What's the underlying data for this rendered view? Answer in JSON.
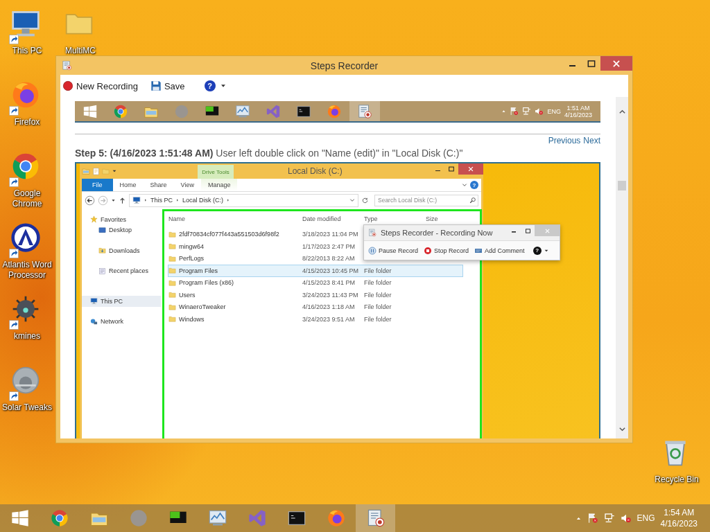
{
  "desktop": {
    "icons": [
      {
        "label": "This PC",
        "kind": "computer",
        "shortcut": true
      },
      {
        "label": "Firefox",
        "kind": "firefox",
        "shortcut": true
      },
      {
        "label": "Google Chrome",
        "kind": "chrome",
        "shortcut": true
      },
      {
        "label": "Atlantis Word Processor",
        "kind": "atlantis",
        "shortcut": true
      },
      {
        "label": "kmines",
        "kind": "mines",
        "shortcut": true
      },
      {
        "label": "Solar Tweaks",
        "kind": "solar",
        "shortcut": true
      }
    ],
    "second_column": [
      {
        "label": "MultiMC",
        "kind": "folder",
        "shortcut": false
      }
    ],
    "corner": [
      {
        "label": "Recycle Bin",
        "kind": "recycle",
        "shortcut": false
      }
    ]
  },
  "steps_recorder": {
    "title": "Steps Recorder",
    "toolbar": [
      {
        "kind": "record",
        "label": "New Recording"
      },
      {
        "kind": "save",
        "label": "Save"
      },
      {
        "kind": "help",
        "label": "?"
      }
    ],
    "captured_taskbar": {
      "apps": [
        {
          "kind": "start",
          "selected": false
        },
        {
          "kind": "chrome",
          "selected": false
        },
        {
          "kind": "explorer",
          "selected": false
        },
        {
          "kind": "circle",
          "selected": false
        },
        {
          "kind": "green",
          "selected": false
        },
        {
          "kind": "monitor",
          "selected": false
        },
        {
          "kind": "vs",
          "selected": false
        },
        {
          "kind": "cmd",
          "selected": false
        },
        {
          "kind": "firefox",
          "selected": false
        },
        {
          "kind": "recorder",
          "selected": true
        }
      ],
      "language": "ENG",
      "time": "1:51 AM",
      "date": "4/16/2023"
    },
    "step_nav": [
      "Previous",
      "Next"
    ],
    "step_title": "**Step 5: (4/16/2023 1:51:48 AM)** User left double click on \"Name (edit)\" in \"Local Disk (C:)\"",
    "screenshot": {
      "explorer": {
        "title": "Local Disk (C:)",
        "context_group": "Drive Tools",
        "ribbon_tabs": [
          {
            "label": "File",
            "kind": "file"
          },
          {
            "label": "Home",
            "kind": "tab"
          },
          {
            "label": "Share",
            "kind": "tab"
          },
          {
            "label": "View",
            "kind": "tab"
          },
          {
            "label": "Manage",
            "kind": "context"
          }
        ],
        "help": "?",
        "breadcrumb": [
          "This PC",
          "Local Disk (C:)"
        ],
        "search": {
          "placeholder": "Search Local Disk (C:)"
        },
        "nav": [
          {
            "label": "Favorites",
            "kind": "star",
            "selected": false,
            "children": [
              {
                "label": "Desktop",
                "kind": "desktop",
                "selected": false
              },
              {
                "label": "Downloads",
                "kind": "downloads",
                "selected": false
              },
              {
                "label": "Recent places",
                "kind": "recent",
                "selected": false
              }
            ]
          },
          {
            "label": "This PC",
            "kind": "computer",
            "selected": true
          },
          {
            "label": "Network",
            "kind": "network",
            "selected": false
          }
        ],
        "columns": [
          "Name",
          "Date modified",
          "Type",
          "Size"
        ],
        "rows": [
          {
            "name": "2fdf70834cf077f443a551503d6f98f2",
            "date": "3/18/2023 11:04 PM",
            "selected": false
          },
          {
            "name": "mingw64",
            "date": "1/17/2023 2:47 PM",
            "selected": false
          },
          {
            "name": "PerfLogs",
            "date": "8/22/2013 8:22 AM",
            "selected": false
          },
          {
            "name": "Program Files",
            "date": "4/15/2023 10:45 PM",
            "type": "File folder",
            "selected": true
          },
          {
            "name": "Program Files (x86)",
            "date": "4/15/2023 8:41 PM",
            "type": "File folder",
            "selected": false
          },
          {
            "name": "Users",
            "date": "3/24/2023 11:43 PM",
            "type": "File folder",
            "selected": false
          },
          {
            "name": "WinaeroTweaker",
            "date": "4/16/2023 1:18 AM",
            "type": "File folder",
            "selected": false
          },
          {
            "name": "Windows",
            "date": "3/24/2023 9:51 AM",
            "type": "File folder",
            "selected": false
          }
        ]
      },
      "recorder_overlay": {
        "title": "Steps Recorder - Recording Now",
        "buttons": [
          {
            "kind": "pause",
            "label": "Pause Record"
          },
          {
            "kind": "stop",
            "label": "Stop Record"
          },
          {
            "kind": "comment",
            "label": "Add Comment"
          },
          {
            "kind": "help",
            "label": "?"
          }
        ]
      }
    }
  },
  "taskbar": {
    "apps": [
      {
        "kind": "start",
        "selected": false
      },
      {
        "kind": "chrome",
        "selected": false
      },
      {
        "kind": "explorer",
        "selected": false
      },
      {
        "kind": "circle",
        "selected": false
      },
      {
        "kind": "green",
        "selected": false
      },
      {
        "kind": "monitor",
        "selected": false
      },
      {
        "kind": "vs",
        "selected": false
      },
      {
        "kind": "cmd",
        "selected": false
      },
      {
        "kind": "firefox",
        "selected": false
      },
      {
        "kind": "recorder",
        "selected": true
      }
    ],
    "language": "ENG",
    "time": "1:54 AM",
    "date": "4/16/2023"
  }
}
